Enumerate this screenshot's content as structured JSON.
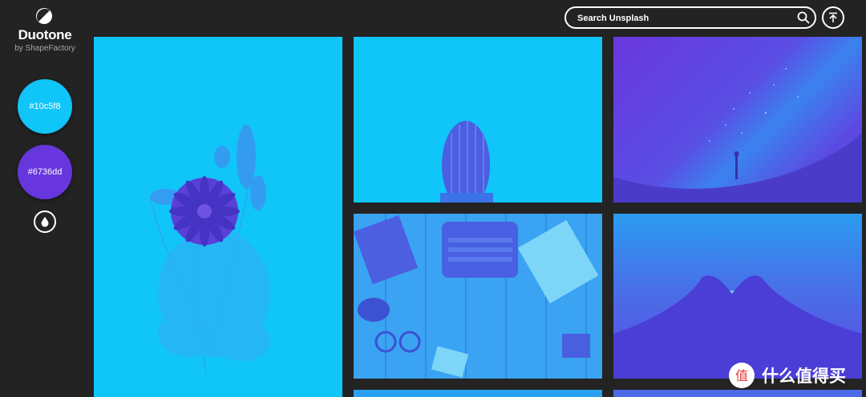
{
  "app": {
    "title": "Duotone",
    "subtitle": "by ShapeFactory"
  },
  "colors": {
    "background": "#232323",
    "primary": "#10c5f8",
    "secondary": "#6736dd"
  },
  "swatches": [
    {
      "label": "#10c5f8",
      "color": "#10c5f8"
    },
    {
      "label": "#6736dd",
      "color": "#6736dd"
    }
  ],
  "icons": {
    "logo": "half-circle-logo-icon",
    "drop": "drop-icon",
    "search": "search-icon",
    "top": "arrow-to-top-icon"
  },
  "search": {
    "placeholder": "Search Unsplash"
  },
  "photos": [
    {
      "subject": "flower bouquet"
    },
    {
      "subject": "cactus"
    },
    {
      "subject": "milky way with silhouette"
    },
    {
      "subject": "desk with typewriter"
    },
    {
      "subject": "hands forming heart"
    }
  ],
  "watermark": {
    "text": "什么值得买"
  }
}
